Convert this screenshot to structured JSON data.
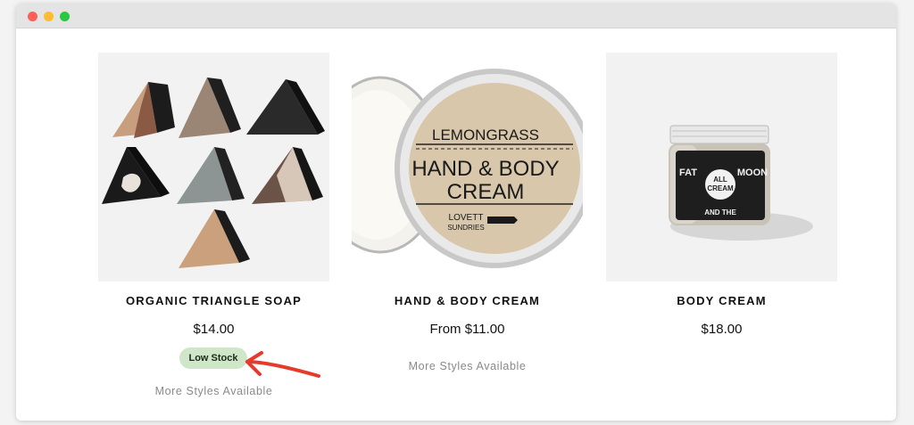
{
  "window": {
    "controls": [
      "close",
      "minimize",
      "zoom"
    ]
  },
  "products": [
    {
      "title": "ORGANIC TRIANGLE SOAP",
      "price": "$14.00",
      "badge": "Low Stock",
      "more_styles": "More Styles Available"
    },
    {
      "title": "HAND & BODY CREAM",
      "price": "From $11.00",
      "more_styles": "More Styles Available",
      "label": {
        "scent": "LEMONGRASS",
        "line1": "HAND & BODY",
        "line2": "CREAM",
        "brand1": "LOVETT",
        "brand2": "SUNDRIES"
      }
    },
    {
      "title": "BODY CREAM",
      "price": "$18.00",
      "label": {
        "top": "ALL",
        "center": "CREAM",
        "arc1": "FAT",
        "arc2": "AND THE",
        "arc3": "MOON"
      }
    }
  ],
  "colors": {
    "badge_bg": "#cfe7c8",
    "arrow": "#e53b2c",
    "muted_text": "#8a8a8a"
  }
}
